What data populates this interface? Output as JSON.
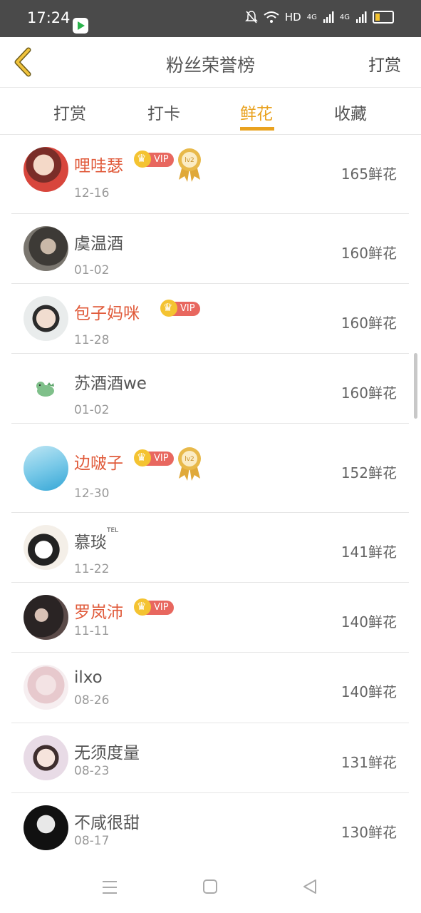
{
  "status_bar": {
    "time": "17:24",
    "network": "HD",
    "signal1": "4G",
    "signal2": "4G"
  },
  "header": {
    "title": "粉丝荣誉榜",
    "right_action": "打赏"
  },
  "tabs": [
    {
      "label": "打赏",
      "active": false
    },
    {
      "label": "打卡",
      "active": false
    },
    {
      "label": "鲜花",
      "active": true
    },
    {
      "label": "收藏",
      "active": false
    }
  ],
  "badges": {
    "vip": "VIP",
    "medal_level": "lv2"
  },
  "list": [
    {
      "name": "哩哇瑟",
      "date": "12-16",
      "flowers": "165鲜花",
      "vip": true,
      "medal": true
    },
    {
      "name": "虞温酒",
      "date": "01-02",
      "flowers": "160鲜花",
      "vip": false,
      "medal": false
    },
    {
      "name": "包子妈咪",
      "date": "11-28",
      "flowers": "160鲜花",
      "vip": true,
      "medal": false
    },
    {
      "name": "苏酒酒we",
      "date": "01-02",
      "flowers": "160鲜花",
      "vip": false,
      "medal": false
    },
    {
      "name": "边啵子",
      "date": "12-30",
      "flowers": "152鲜花",
      "vip": true,
      "medal": true
    },
    {
      "name": "慕琰",
      "name_sup": "TEL",
      "date": "11-22",
      "flowers": "141鲜花",
      "vip": false,
      "medal": false
    },
    {
      "name": "罗岚沛",
      "date": "11-11",
      "flowers": "140鲜花",
      "vip": true,
      "medal": false
    },
    {
      "name": "ilxo",
      "date": "08-26",
      "flowers": "140鲜花",
      "vip": false,
      "medal": false
    },
    {
      "name": "无须度量",
      "date": "08-23",
      "flowers": "131鲜花",
      "vip": false,
      "medal": false
    },
    {
      "name": "不咸很甜",
      "date": "08-17",
      "flowers": "130鲜花",
      "vip": false,
      "medal": false
    }
  ],
  "colors": {
    "accent": "#e9a21f",
    "vip_name": "#e05a3a",
    "vip_badge": "#e8675f",
    "crown": "#f4c331"
  }
}
